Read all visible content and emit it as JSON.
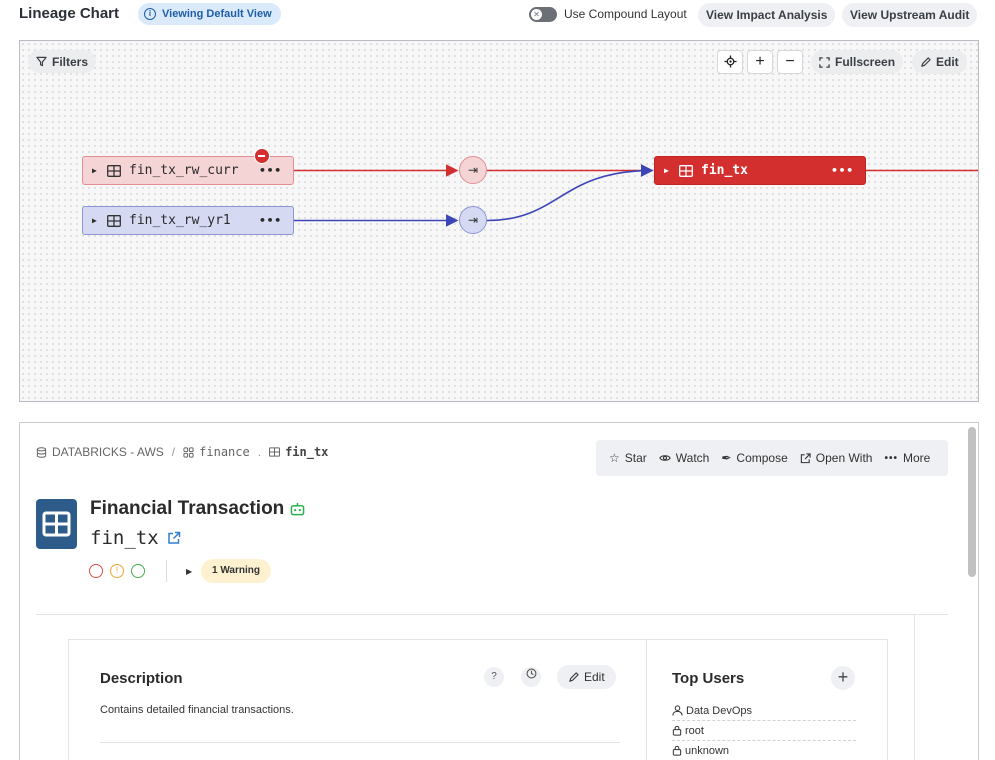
{
  "header": {
    "title": "Lineage Chart",
    "view_pill": "Viewing Default View",
    "compound_label": "Use Compound Layout",
    "impact_button": "View Impact Analysis",
    "upstream_button": "View Upstream Audit"
  },
  "canvas": {
    "filters_label": "Filters",
    "fullscreen_label": "Fullscreen",
    "edit_label": "Edit",
    "nodes": {
      "curr": "fin_tx_rw_curr",
      "yr1": "fin_tx_rw_yr1",
      "main": "fin_tx"
    }
  },
  "panel": {
    "breadcrumb": {
      "source": "DATABRICKS - AWS",
      "schema": "finance",
      "table": "fin_tx"
    },
    "actions": {
      "star": "Star",
      "watch": "Watch",
      "compose": "Compose",
      "open_with": "Open With",
      "more": "More"
    },
    "entity": {
      "title": "Financial Transaction",
      "name": "fin_tx",
      "warning_pill": "1 Warning"
    },
    "description": {
      "title": "Description",
      "text": "Contains detailed financial transactions.",
      "edit_label": "Edit"
    },
    "top_users": {
      "title": "Top Users",
      "users": [
        "Data DevOps",
        "root",
        "unknown"
      ]
    }
  },
  "colors": {
    "red_edge": "#d32f2f",
    "blue_edge": "#3b45b5",
    "entity_icon": "#2e5c8a",
    "view_pill_bg": "#dbeafb"
  }
}
